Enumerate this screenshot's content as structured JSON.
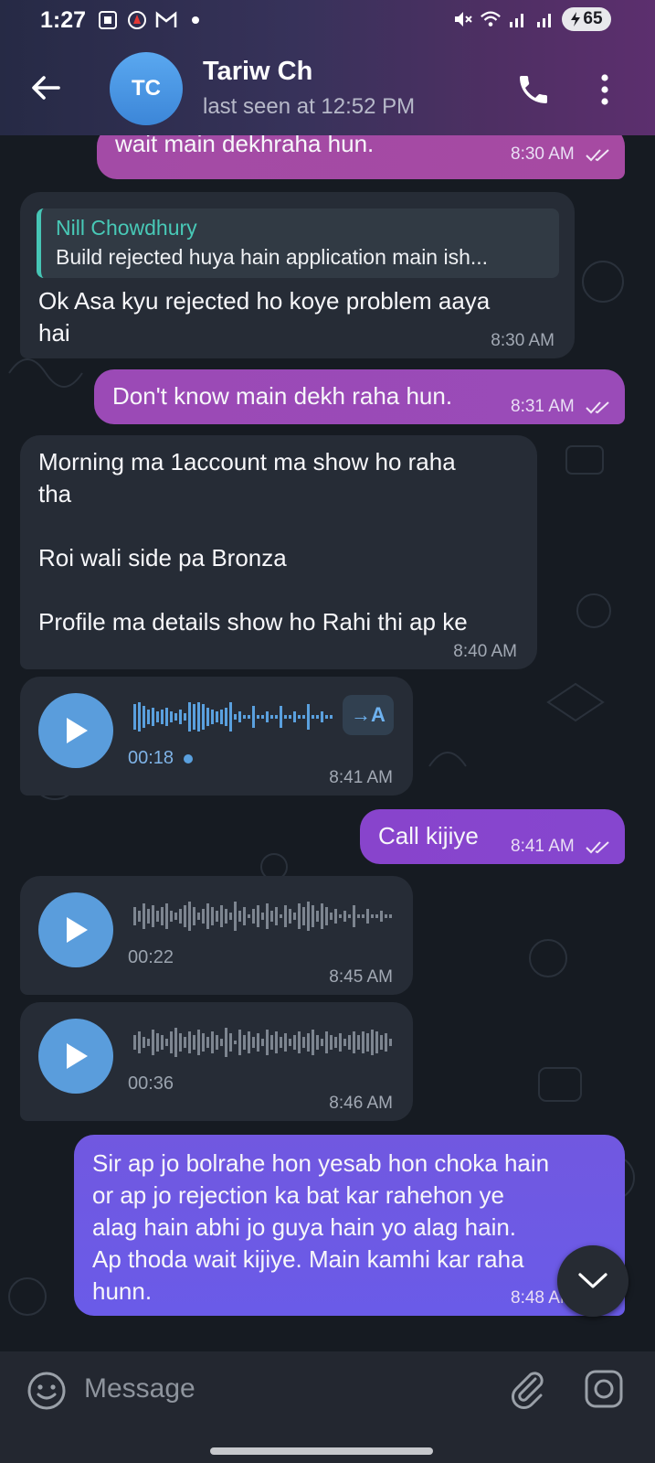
{
  "status_bar": {
    "time": "1:27",
    "battery": "65"
  },
  "header": {
    "avatar_initials": "TC",
    "contact_name": "Tariw Ch",
    "last_seen": "last seen at 12:52 PM"
  },
  "messages": [
    {
      "direction": "out",
      "text": "wait main dekhraha hun.",
      "time": "8:30 AM",
      "read": true
    },
    {
      "direction": "in",
      "reply_to_name": "Nill Chowdhury",
      "reply_to_text": "Build rejected huya hain application main ish...",
      "text": "Ok Asa kyu rejected ho koye problem aaya\nhai",
      "time": "8:30 AM"
    },
    {
      "direction": "out",
      "text": "Don't know main dekh raha hun.",
      "time": "8:31 AM",
      "read": true
    },
    {
      "direction": "in",
      "text": "Morning ma 1account ma show ho raha\ntha\n\nRoi wali side pa Bronza\n\nProfile ma details show ho Rahi thi ap ke",
      "time": "8:40 AM"
    },
    {
      "direction": "in",
      "type": "voice",
      "duration": "00:18",
      "unplayed": true,
      "transcribe_label": "→A",
      "time": "8:41 AM"
    },
    {
      "direction": "out",
      "text": "Call kijiye",
      "time": "8:41 AM",
      "read": true
    },
    {
      "direction": "in",
      "type": "voice",
      "duration": "00:22",
      "time": "8:45 AM"
    },
    {
      "direction": "in",
      "type": "voice",
      "duration": "00:36",
      "time": "8:46 AM"
    },
    {
      "direction": "out",
      "text": "Sir ap jo bolrahe hon yesab hon choka hain\nor ap jo rejection ka bat kar rahehon ye\nalag hain abhi jo guya hain yo alag hain.\nAp thoda wait kijiye. Main kamhi kar raha\nhunn.",
      "time": "8:48 AM",
      "read": true
    }
  ],
  "input": {
    "placeholder": "Message"
  },
  "colors": {
    "header_gradient_start": "#262a45",
    "header_gradient_end": "#5c2f6e",
    "incoming_bubble": "#262c36",
    "outgoing_bubble_pink": "#a44ca6",
    "outgoing_bubble_purple": "#8a45c8",
    "outgoing_bubble_indigo": "#6b5ae6",
    "reply_accent": "#46c5b5",
    "voice_accent": "#5a9ddc"
  },
  "icons": [
    "back-arrow-icon",
    "phone-icon",
    "more-vert-icon",
    "play-icon",
    "chevron-down-icon",
    "emoji-icon",
    "attach-icon",
    "camera-icon",
    "double-check-icon"
  ]
}
